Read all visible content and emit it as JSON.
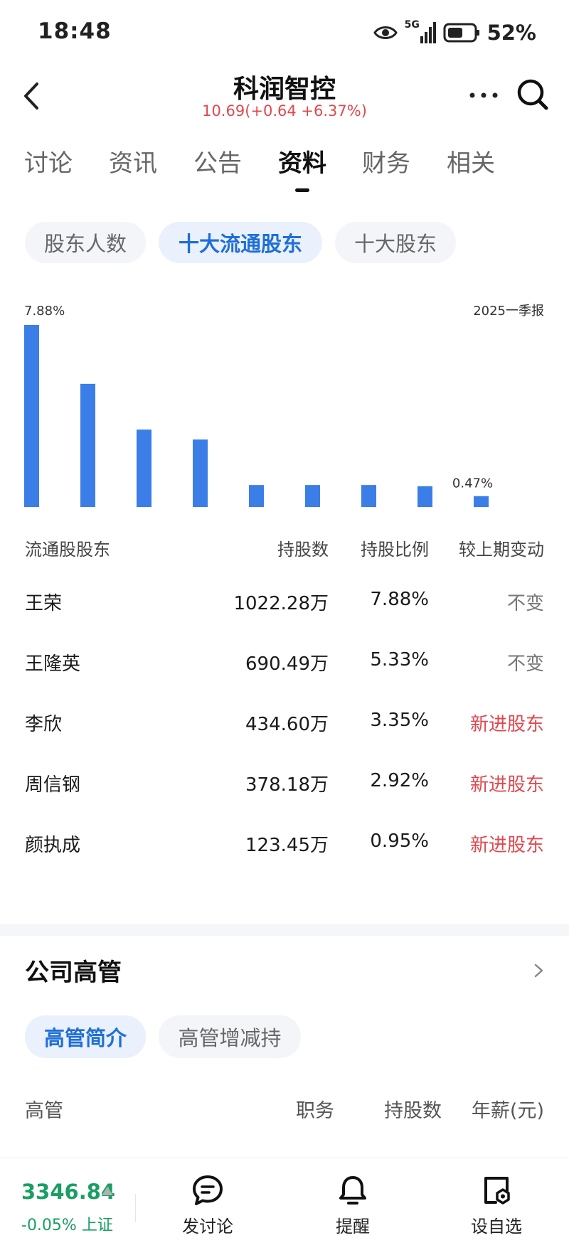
{
  "status_bar": {
    "time": "18:48",
    "network": "5G",
    "battery": "52%",
    "icons": [
      "eye-icon",
      "signal-icon",
      "battery-icon"
    ]
  },
  "header": {
    "stock_name": "科润智控",
    "price_line": "10.69(+0.64 +6.37%)",
    "price_color": "#e0484e",
    "icons": [
      "back-icon",
      "more-icon",
      "search-icon"
    ]
  },
  "tabs": [
    {
      "label": "讨论"
    },
    {
      "label": "资讯"
    },
    {
      "label": "公告"
    },
    {
      "label": "资料"
    },
    {
      "label": "财务"
    },
    {
      "label": "相关"
    }
  ],
  "active_tab": "资料",
  "shareholder_pills": [
    {
      "label": "股东人数"
    },
    {
      "label": "十大流通股东"
    },
    {
      "label": "十大股东"
    }
  ],
  "active_shareholder_pill": "十大流通股东",
  "chart_data": {
    "type": "bar",
    "color": "#3b7ee8",
    "max_label": "7.88%",
    "min_label": "0.47%",
    "period_label": "2025一季报",
    "values": [
      7.88,
      5.33,
      3.35,
      2.92,
      0.95,
      0.95,
      0.95,
      0.9,
      0.47
    ],
    "ylim": [
      0,
      7.88
    ]
  },
  "table": {
    "headers": {
      "holder": "流通股股东",
      "shares": "持股数",
      "ratio": "持股比例",
      "change": "较上期变动"
    },
    "rows": [
      {
        "name": "王荣",
        "shares": "1022.28万",
        "ratio": "7.88%",
        "change": "不变",
        "is_new": false
      },
      {
        "name": "王隆英",
        "shares": "690.49万",
        "ratio": "5.33%",
        "change": "不变",
        "is_new": false
      },
      {
        "name": "李欣",
        "shares": "434.60万",
        "ratio": "3.35%",
        "change": "新进股东",
        "is_new": true
      },
      {
        "name": "周信钢",
        "shares": "378.18万",
        "ratio": "2.92%",
        "change": "新进股东",
        "is_new": true
      },
      {
        "name": "颜执成",
        "shares": "123.45万",
        "ratio": "0.95%",
        "change": "新进股东",
        "is_new": true
      }
    ]
  },
  "executives": {
    "title": "公司高管",
    "pills": [
      {
        "label": "高管简介"
      },
      {
        "label": "高管增减持"
      }
    ],
    "active_pill": "高管简介",
    "headers": {
      "name": "高管",
      "position": "职务",
      "shares": "持股数",
      "salary": "年薪(元)"
    }
  },
  "bottom_bar": {
    "index_value": "3346.84",
    "index_change": "-0.05% 上证",
    "index_color": "#1a9e63",
    "post_label": "发讨论",
    "remind_label": "提醒",
    "watchlist_label": "设自选"
  }
}
